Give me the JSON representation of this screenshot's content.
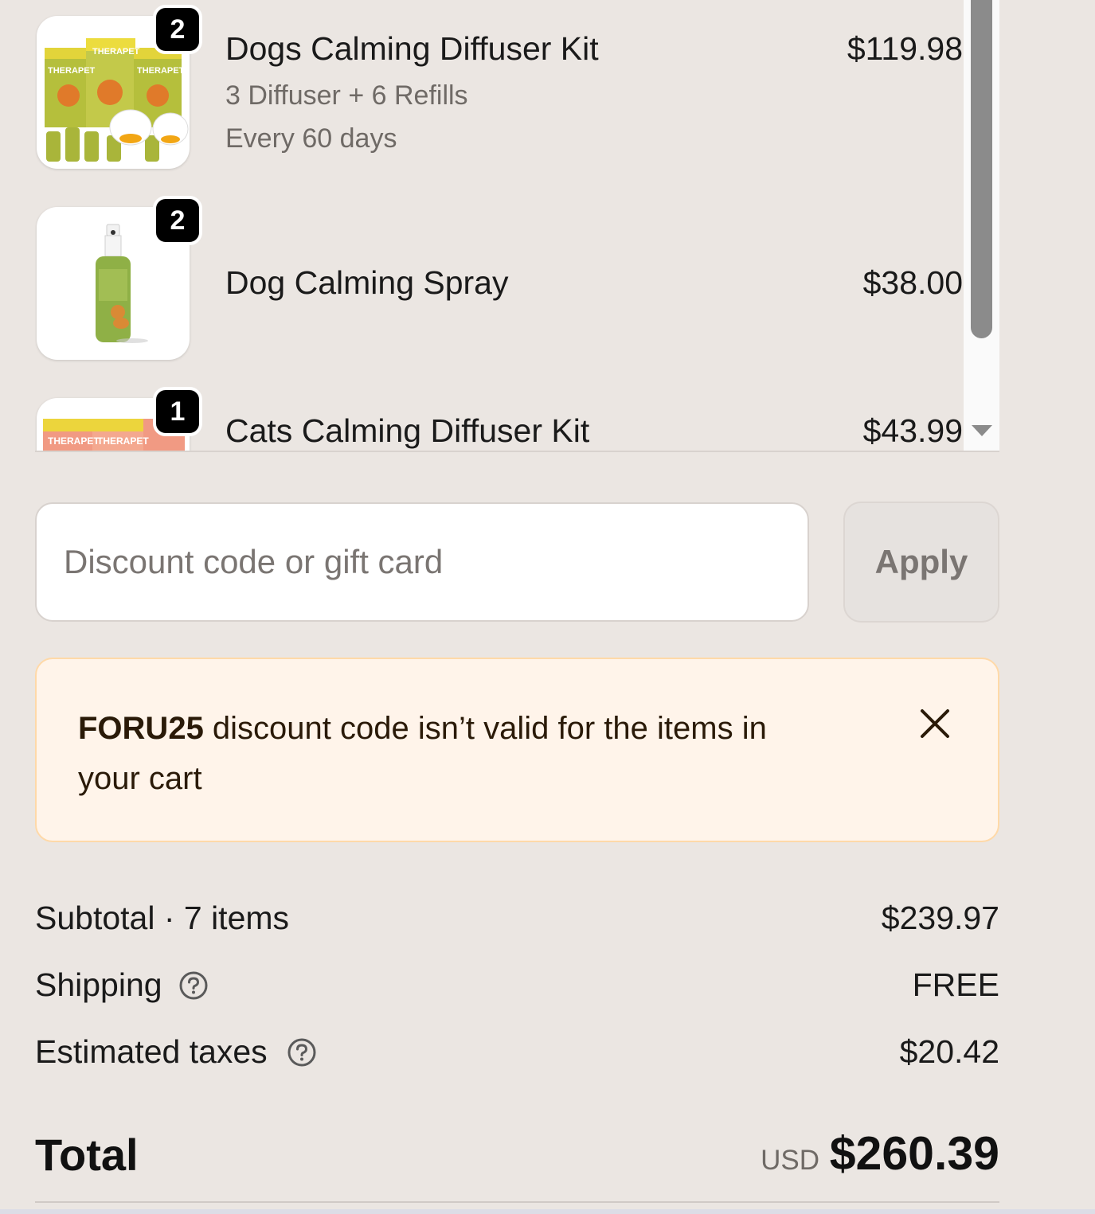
{
  "cart": {
    "items": [
      {
        "name": "Dogs Calming Diffuser Kit",
        "variant": "3 Diffuser + 6 Refills",
        "subscription": "Every 60 days",
        "price": "$119.98",
        "quantity": "2",
        "image_brand_text": "THERAPET"
      },
      {
        "name": "Dog Calming Spray",
        "price": "$38.00",
        "quantity": "2"
      },
      {
        "name": "Cats Calming Diffuser Kit",
        "price": "$43.99",
        "quantity": "1",
        "image_brand_text": "THERAPET"
      }
    ]
  },
  "discount": {
    "placeholder": "Discount code or gift card",
    "apply_label": "Apply"
  },
  "error": {
    "code": "FORU25",
    "message": " discount code isn’t valid for the items in your cart"
  },
  "summary": {
    "subtotal_label": "Subtotal · 7 items",
    "subtotal_value": "$239.97",
    "shipping_label": "Shipping",
    "shipping_value": "FREE",
    "taxes_label": "Estimated taxes",
    "taxes_value": "$20.42",
    "total_label": "Total",
    "total_currency": "USD",
    "total_value": "$260.39"
  },
  "colors": {
    "page_bg": "#ebe6e2",
    "badge_bg": "#000000",
    "banner_bg": "#fff4ea",
    "banner_border": "#ffd9a8"
  },
  "icons": {
    "help": "question-circle-icon",
    "close": "close-icon",
    "scroll_down": "scroll-down-arrow-icon"
  }
}
